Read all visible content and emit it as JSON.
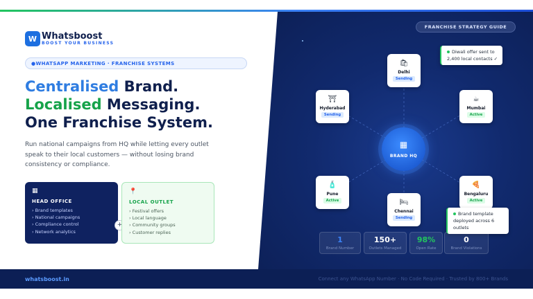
{
  "brand": {
    "name": "Whatsboost",
    "tagline": "BOOST YOUR BUSINESS",
    "logo_letter": "W"
  },
  "pill": "●WHATSAPP MARKETING · FRANCHISE SYSTEMS",
  "headline": {
    "line1_accent": "Centralised",
    "line1_rest": " Brand.",
    "line2_accent": "Localised",
    "line2_rest": " Messaging.",
    "line3": "One Franchise System."
  },
  "description": "Run national campaigns from HQ while letting every outlet speak to their local customers — without losing brand consistency or compliance.",
  "cards": {
    "head_office": {
      "icon": "building-icon",
      "title": "HEAD OFFICE",
      "items": [
        "Brand templates",
        "National campaigns",
        "Compliance control",
        "Network analytics"
      ]
    },
    "plus": "+",
    "local_outlet": {
      "icon": "pin-icon",
      "title": "LOCAL OUTLET",
      "items": [
        "Festival offers",
        "Local language",
        "Community groups",
        "Customer replies"
      ]
    }
  },
  "guide_label": "FRANCHISE STRATEGY GUIDE",
  "hub": {
    "icon": "building-icon",
    "label": "BRAND HQ"
  },
  "nodes": [
    {
      "name": "Delhi",
      "status": "Sending",
      "icon": "shop-icon"
    },
    {
      "name": "Hyderabad",
      "status": "Sending",
      "icon": "store-icon"
    },
    {
      "name": "Mumbai",
      "status": "Active",
      "icon": "cup-icon"
    },
    {
      "name": "Pune",
      "status": "Active",
      "icon": "bottle-icon"
    },
    {
      "name": "Chennai",
      "status": "Sending",
      "icon": "bed-icon"
    },
    {
      "name": "Bengaluru",
      "status": "Active",
      "icon": "pizza-icon"
    }
  ],
  "toasts": {
    "diwali": "Diwali offer sent to 2,400 local contacts ✓",
    "template": "Brand template deployed across 6 outlets"
  },
  "stats": [
    {
      "value": "1",
      "label": "Brand Number",
      "color": "#3b82f6"
    },
    {
      "value": "150+",
      "label": "Outlets Managed",
      "color": "#ffffff"
    },
    {
      "value": "98%",
      "label": "Open Rate",
      "color": "#22c55e"
    },
    {
      "value": "0",
      "label": "Brand Violations",
      "color": "#ffffff"
    }
  ],
  "footer": {
    "url": "whatsboost.in",
    "note": "Connect any WhatsApp Number · No Code Required · Trusted by 800+ Brands"
  },
  "colors": {
    "accent_blue": "#2f7de1",
    "accent_green": "#16a34a",
    "navy": "#0f1f4d"
  }
}
